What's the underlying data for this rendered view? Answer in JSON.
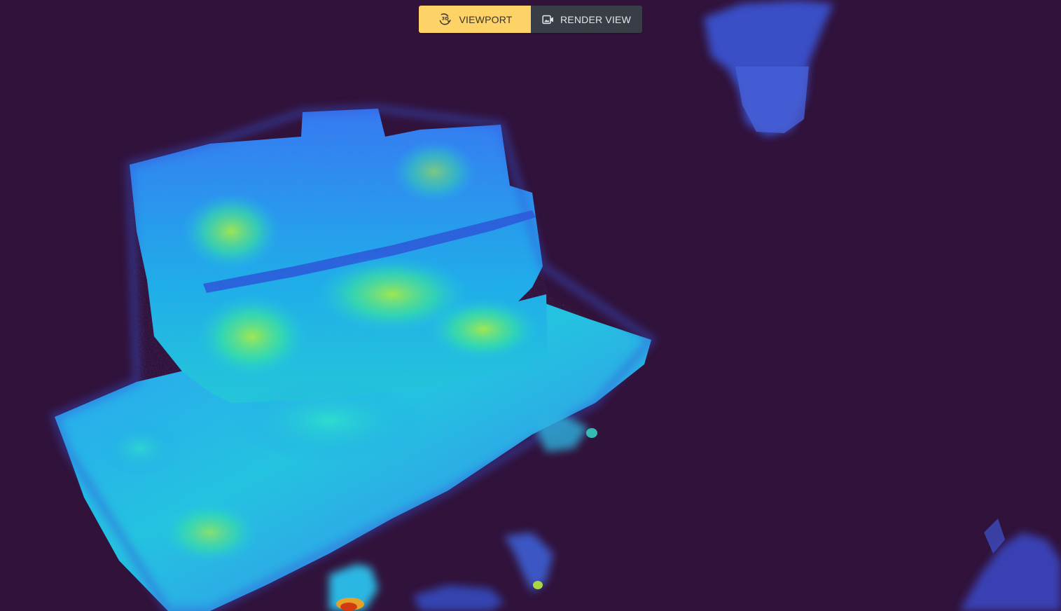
{
  "toolbar": {
    "viewport_label": "VIEWPORT",
    "render_view_label": "RENDER VIEW",
    "active_mode": "viewport",
    "viewport_icon": "3d-rotate-icon",
    "render_view_icon": "camera-image-icon"
  },
  "scene": {
    "colormap": "turbo",
    "background_color": "#31123b"
  },
  "colors": {
    "active_button": "#fdd267",
    "inactive_button": "#393e46"
  }
}
